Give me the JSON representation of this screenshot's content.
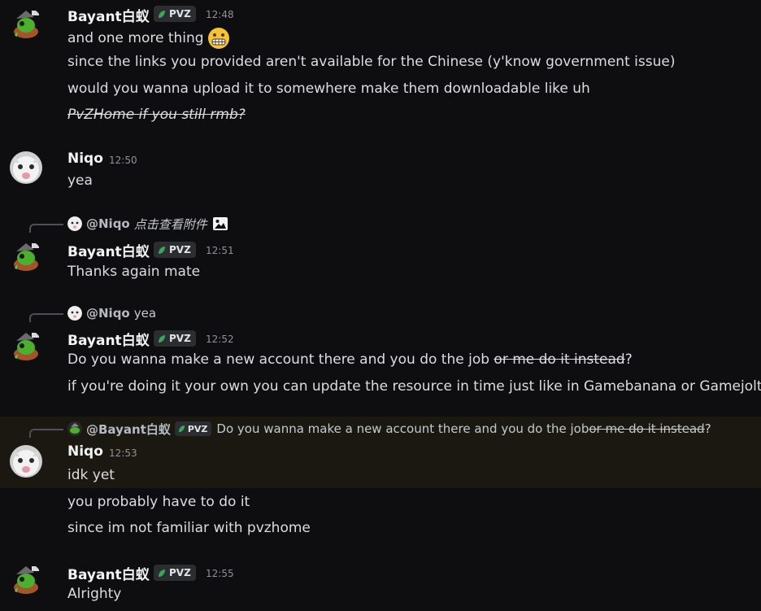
{
  "messages": [
    {
      "author": "Bayant白蚁",
      "tag": "PVZ",
      "time": "12:48",
      "lines": [
        "and one more thing",
        "since the links you provided aren't available for the Chinese (y'know government issue)",
        "would you wanna upload it to somewhere make them downloadable like uh",
        "PvZHome if you still rmb?"
      ],
      "emoji": "grimacing"
    },
    {
      "author": "Niqo",
      "time": "12:50",
      "lines": [
        "yea"
      ]
    },
    {
      "reply": {
        "author": "@Niqo",
        "text": "点击查看附件"
      },
      "author": "Bayant白蚁",
      "tag": "PVZ",
      "time": "12:51",
      "lines": [
        "Thanks again mate"
      ]
    },
    {
      "reply": {
        "author": "@Niqo",
        "text": "yea"
      },
      "author": "Bayant白蚁",
      "tag": "PVZ",
      "time": "12:52",
      "lines": [
        "Do you wanna make a new account there and you do the job ",
        "or me do it instead",
        "?",
        "if you're doing it your own you can update the resource in time just like in Gamebanana or Gamejolt"
      ]
    },
    {
      "reply": {
        "author": "@Bayant白蚁",
        "tag": "PVZ",
        "text": "Do you wanna make a new account there and you do the job ",
        "strike": "or me do it instead",
        "end": "?"
      },
      "author": "Niqo",
      "time": "12:53",
      "lines": [
        "idk yet",
        "you probably have to do it",
        "since im not familiar with pvzhome"
      ]
    },
    {
      "author": "Bayant白蚁",
      "tag": "PVZ",
      "time": "12:55",
      "lines": [
        "Alrighty"
      ]
    }
  ],
  "colors": {
    "background": "#0e0e11",
    "highlight": "#1b1812",
    "leaf": "#3ba55d"
  }
}
